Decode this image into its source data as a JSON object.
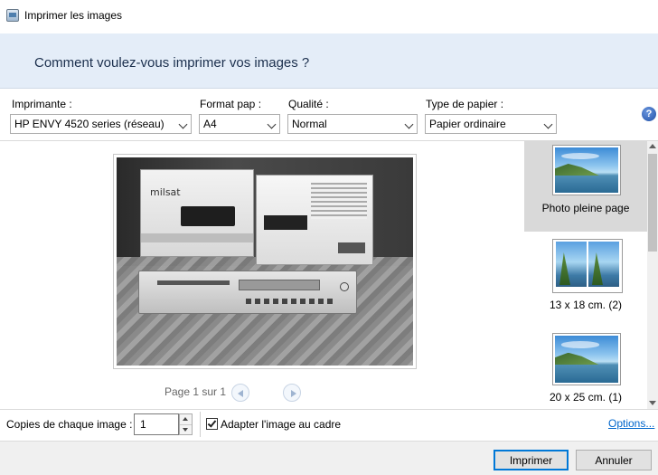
{
  "window": {
    "title": "Imprimer les images",
    "icon": "printer-photo-icon"
  },
  "header": {
    "question": "Comment voulez-vous imprimer vos images ?"
  },
  "options": {
    "printer": {
      "label": "Imprimante :",
      "value": "HP ENVY 4520 series (réseau)"
    },
    "paper_size": {
      "label": "Format pap :",
      "value": "A4"
    },
    "quality": {
      "label": "Qualité :",
      "value": "Normal"
    },
    "paper_type": {
      "label": "Type de papier :",
      "value": "Papier ordinaire"
    },
    "help_glyph": "?"
  },
  "preview": {
    "page_text": "Page 1 sur 1",
    "photo_brand": "milsat",
    "prev_icon": "previous-page-icon",
    "next_icon": "next-page-icon"
  },
  "layouts": [
    {
      "label": "Photo pleine page",
      "selected": true
    },
    {
      "label": "13 x 18 cm. (2)",
      "selected": false
    },
    {
      "label": "20 x 25 cm. (1)",
      "selected": false
    }
  ],
  "copies": {
    "label": "Copies de chaque image :",
    "value": "1"
  },
  "fit": {
    "label": "Adapter l'image au cadre",
    "checked": true
  },
  "options_link": "Options...",
  "buttons": {
    "print": "Imprimer",
    "cancel": "Annuler"
  },
  "colors": {
    "header_bg": "#e4edf8",
    "link": "#0066cc",
    "accent": "#0078d7"
  }
}
